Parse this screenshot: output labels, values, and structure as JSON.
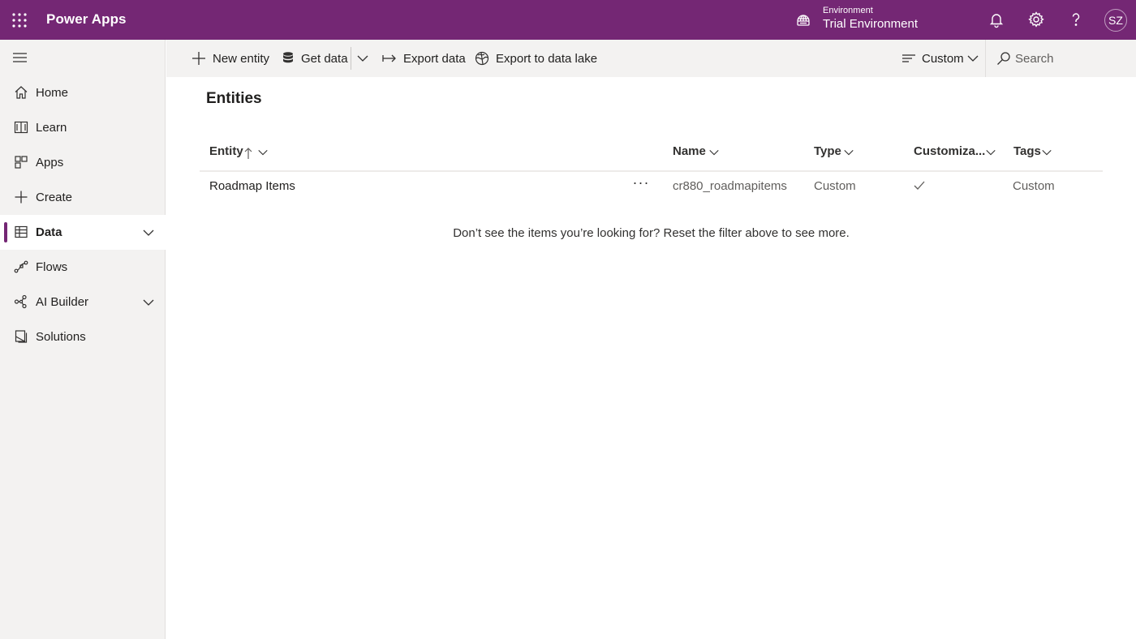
{
  "header": {
    "app_title": "Power Apps",
    "environment_label": "Environment",
    "environment_name": "Trial Environment",
    "avatar_initials": "SZ",
    "brand_color": "#742774"
  },
  "sidebar": {
    "items": [
      {
        "label": "Home",
        "icon": "home-icon"
      },
      {
        "label": "Learn",
        "icon": "book-icon"
      },
      {
        "label": "Apps",
        "icon": "apps-icon"
      },
      {
        "label": "Create",
        "icon": "plus-icon"
      },
      {
        "label": "Data",
        "icon": "table-icon",
        "active": true,
        "expandable": true
      },
      {
        "label": "Flows",
        "icon": "flow-icon"
      },
      {
        "label": "AI Builder",
        "icon": "ai-builder-icon",
        "expandable": true
      },
      {
        "label": "Solutions",
        "icon": "solutions-icon"
      }
    ]
  },
  "commandbar": {
    "new_entity": "New entity",
    "get_data": "Get data",
    "export_data": "Export data",
    "export_lake": "Export to data lake",
    "view_filter": "Custom",
    "search_placeholder": "Search"
  },
  "main": {
    "title": "Entities",
    "columns": [
      "Entity",
      "Name",
      "Type",
      "Customiza...",
      "Tags"
    ],
    "rows": [
      {
        "entity": "Roadmap Items",
        "more": "···",
        "name": "cr880_roadmapitems",
        "type": "Custom",
        "customizable": true,
        "tags": "Custom"
      }
    ],
    "filter_message": "Don’t see the items you’re looking for? Reset the filter above to see more."
  }
}
